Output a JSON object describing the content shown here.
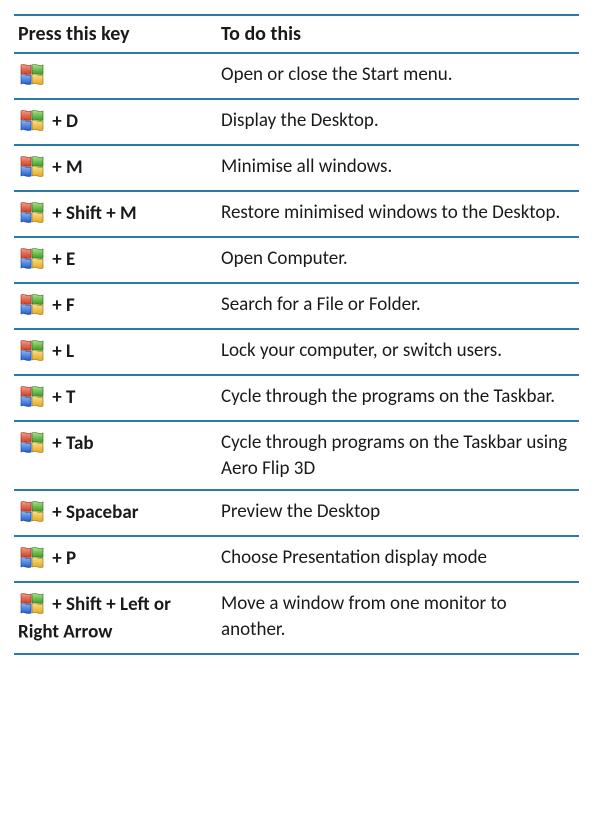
{
  "headers": {
    "key": "Press this key",
    "action": "To do this"
  },
  "rows": [
    {
      "key_suffix": "",
      "action": "Open or close the Start menu."
    },
    {
      "key_suffix": " + D",
      "action": "Display the Desktop."
    },
    {
      "key_suffix": " + M",
      "action": "Minimise all windows."
    },
    {
      "key_suffix": " + Shift + M",
      "action": "Restore minimised windows to the Desktop."
    },
    {
      "key_suffix": " + E",
      "action": "Open Computer."
    },
    {
      "key_suffix": " + F",
      "action": "Search for a File or Folder."
    },
    {
      "key_suffix": " + L",
      "action": "Lock your computer, or switch users."
    },
    {
      "key_suffix": " + T",
      "action": "Cycle through the programs on the Taskbar."
    },
    {
      "key_suffix": " + Tab",
      "action": "Cycle through programs on the Taskbar using Aero Flip 3D"
    },
    {
      "key_suffix": " + Spacebar",
      "action": "Preview the Desktop"
    },
    {
      "key_suffix": " + P",
      "action": "Choose Presentation display mode"
    },
    {
      "key_suffix": " + Shift + Left or Right Arrow",
      "action": "Move a window from one monitor to another."
    }
  ],
  "icons": {
    "windows": "windows-logo-icon"
  }
}
